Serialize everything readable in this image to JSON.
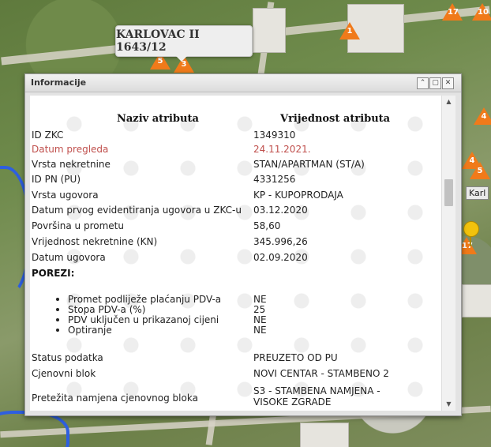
{
  "map": {
    "tooltip_label": "KARLOVAC II 1643/12",
    "side_label": "Karl",
    "markers": [
      "17",
      "10",
      "1",
      "5",
      "3",
      "4",
      "5",
      "4",
      "17"
    ]
  },
  "panel": {
    "title": "Informacije",
    "buttons": {
      "collapse": "⌃",
      "restore": "▢",
      "close": "✕"
    },
    "header_name": "Naziv atributa",
    "header_value": "Vrijednost atributa",
    "rows": [
      {
        "name": "ID ZKC",
        "value": "1349310"
      },
      {
        "name": "Datum pregleda",
        "value": "24.11.2021."
      },
      {
        "name": "Vrsta nekretnine",
        "value": "STAN/APARTMAN (ST/A)"
      },
      {
        "name": "ID PN (PU)",
        "value": "4331256"
      },
      {
        "name": "Vrsta ugovora",
        "value": "KP - KUPOPRODAJA"
      },
      {
        "name": "Datum prvog evidentiranja ugovora u ZKC-u",
        "value": "03.12.2020"
      },
      {
        "name": "Površina u prometu",
        "value": "58,60"
      },
      {
        "name": "Vrijednost nekretnine (KN)",
        "value": "345.996,26"
      },
      {
        "name": "Datum ugovora",
        "value": "02.09.2020"
      }
    ],
    "taxes_heading": "POREZI:",
    "taxes": [
      {
        "name": "Promet podliježe plaćanju PDV-a",
        "value": "NE"
      },
      {
        "name": "Stopa PDV-a (%)",
        "value": "25"
      },
      {
        "name": "PDV uključen u prikazanoj cijeni",
        "value": "NE"
      },
      {
        "name": "Optiranje",
        "value": "NE"
      }
    ],
    "rows_after": [
      {
        "name": "Status podatka",
        "value": "PREUZETO OD PU"
      },
      {
        "name": "Cjenovni blok",
        "value": "NOVI CENTAR - STAMBENO 2"
      }
    ],
    "last_row": {
      "name": "Pretežita namjena cjenovnog bloka",
      "value_line1": "S3 - STAMBENA NAMJENA -",
      "value_line2": "VISOKE ZGRADE"
    }
  },
  "colors": {
    "highlight_row": "#c0504d",
    "marker_orange": "#f07a1a",
    "river_blue": "#2e5fe0"
  }
}
